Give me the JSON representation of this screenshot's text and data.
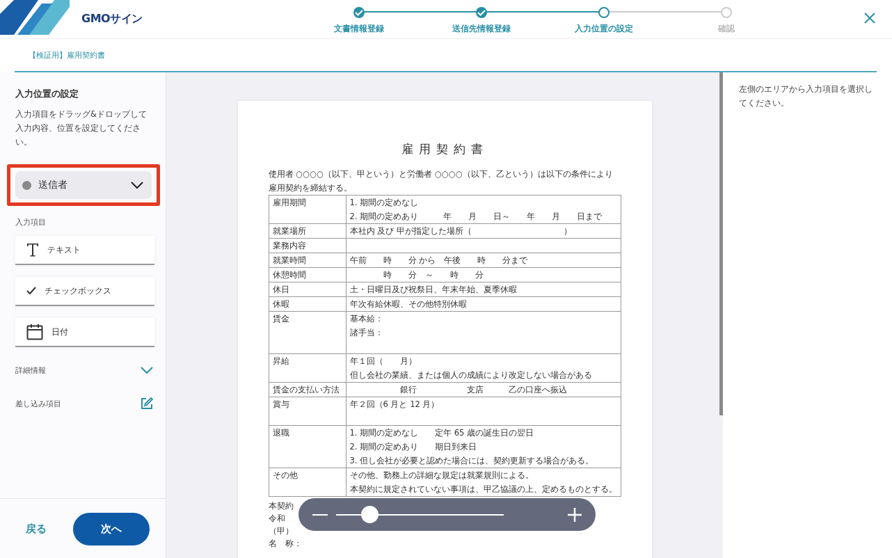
{
  "header": {
    "logo": "GMOサイン",
    "steps": [
      {
        "label": "文書情報登録",
        "done": true,
        "selected": false
      },
      {
        "label": "送信先情報登録",
        "done": true,
        "selected": false
      },
      {
        "label": "入力位置の設定",
        "done": false,
        "selected": true
      },
      {
        "label": "確認",
        "done": false,
        "selected": false
      }
    ]
  },
  "breadcrumb": "【検証用】雇用契約書",
  "sidebar": {
    "title": "入力位置の設定",
    "description": "入力項目をドラッグ&ドロップして入力内容、位置を設定してください。",
    "signer_select": {
      "value": "送信者",
      "highlighted": true
    },
    "items_label": "入力項目",
    "items": [
      {
        "kind": "text",
        "label": "テキスト"
      },
      {
        "kind": "checkbox",
        "label": "チェックボックス"
      },
      {
        "kind": "date",
        "label": "日付"
      }
    ],
    "sections": [
      {
        "kind": "expand",
        "label": "詳細情報"
      },
      {
        "kind": "edit",
        "label": "差し込み項目"
      }
    ],
    "back": "戻る",
    "next": "次へ"
  },
  "document": {
    "title": "雇用契約書",
    "intro": "使用者 ○○○○（以下、甲という）と労働者 ○○○○（以下、乙という）は以下の条件により雇用契約を締結する。",
    "rows": [
      {
        "label": "雇用期間",
        "lines": [
          "1. 期間の定めなし",
          "2. 期間の定めあり　　　年　　月　　日～　　年　　月　　日まで"
        ],
        "tall": false
      },
      {
        "label": "就業場所",
        "lines": [
          "本社内 及び 甲が指定した場所（　　　　　　　　　　　）"
        ],
        "tall": false
      },
      {
        "label": "業務内容",
        "tall": false
      },
      {
        "label": "就業時間",
        "lines": [
          "午前　　時　　分 から　午後　　時　　分まで"
        ],
        "tall": false
      },
      {
        "label": "休憩時間",
        "lines": [
          "　　　　時　　分　～　　時　　分"
        ],
        "tall": false
      },
      {
        "label": "休日",
        "lines": [
          "土・日曜日及び祝祭日、年末年始、夏季休暇"
        ],
        "tall": false
      },
      {
        "label": "休暇",
        "lines": [
          "年次有給休暇、その他特別休暇"
        ],
        "tall": false
      },
      {
        "label": "賃金",
        "lines": [
          "基本給：",
          "諸手当："
        ],
        "tall": true
      },
      {
        "label": "昇給",
        "lines": [
          "年１回（　　月）",
          "但し会社の業績、または個人の成績により改定しない場合がある"
        ],
        "tall": false
      },
      {
        "label": "賃金の支払い方法",
        "lines": [
          "　　　　　　銀行　　　　　　支店　　　乙の口座へ振込"
        ],
        "tall": false
      },
      {
        "label": "賞与",
        "lines": [
          "年２回（6 月と 12 月）"
        ],
        "tall": true
      },
      {
        "label": "退職",
        "lines": [
          "1. 期間の定めなし　　定年 65 歳の誕生日の翌日",
          "2. 期間の定めあり　　期日到来日",
          "3. 但し会社が必要と認めた場合には、契約更新する場合がある。"
        ],
        "tall": false
      },
      {
        "label": "その他",
        "lines": [
          "その他、勤務上の詳細な規定は就業規則による。",
          "本契約に規定されていない事項は、甲乙協議の上、定めるものとする。"
        ],
        "tall": false
      }
    ],
    "footer": [
      "本契約",
      "令和",
      "（甲）",
      "名　称："
    ]
  },
  "zoom": {
    "level": 0.2
  },
  "right_panel": {
    "message": "左側のエリアから入力項目を選択してください。"
  }
}
